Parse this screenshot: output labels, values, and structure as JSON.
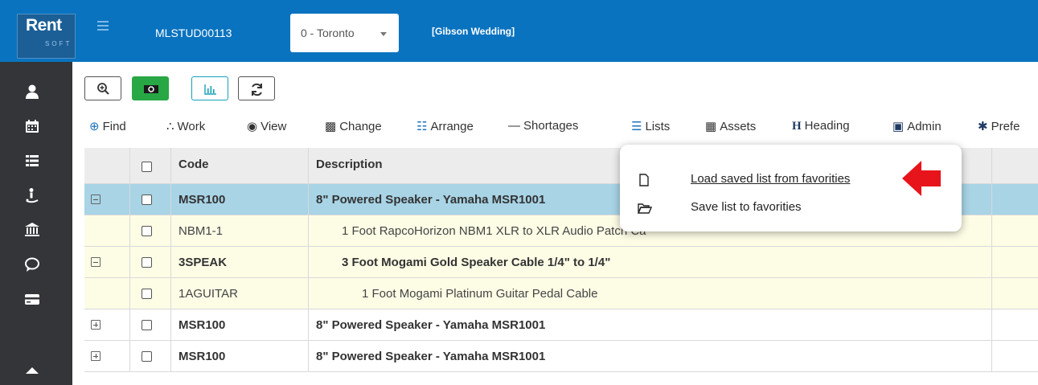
{
  "header": {
    "logo_text": "Rent",
    "logo_sub": "SOFT",
    "job_code": "MLSTUD00113",
    "location": "0 - Toronto",
    "job_name": "[Gibson Wedding]"
  },
  "sidebar": {
    "icons": [
      "user-icon",
      "calendar-icon",
      "list-icon",
      "person-dolly-icon",
      "bank-icon",
      "chat-icon",
      "card-icon",
      "tag-icon"
    ]
  },
  "toolbar": {
    "buttons": [
      "zoom-in-icon",
      "money-icon",
      "chart-icon",
      "refresh-icon"
    ],
    "money_color": "#28a745",
    "chart_color": "#17a2b8"
  },
  "menubar": {
    "items": [
      {
        "label": "Find",
        "icon": "search-plus-icon"
      },
      {
        "label": "Work",
        "icon": "spinner-icon"
      },
      {
        "label": "View",
        "icon": "eye-icon"
      },
      {
        "label": "Change",
        "icon": "edit-icon"
      },
      {
        "label": "Arrange",
        "icon": "sitemap-icon"
      },
      {
        "label": "Shortages",
        "icon": "minus-icon"
      },
      {
        "label": "Lists",
        "icon": "list-icon"
      },
      {
        "label": "Assets",
        "icon": "calendar-icon"
      },
      {
        "label": "Heading",
        "icon": "heading-icon"
      },
      {
        "label": "Admin",
        "icon": "lock-icon"
      },
      {
        "label": "Prefe",
        "icon": "gear-icon"
      }
    ]
  },
  "grid": {
    "headers": {
      "code": "Code",
      "description": "Description"
    },
    "rows": [
      {
        "toggle": "minus",
        "code": "MSR100",
        "description": "8\" Powered Speaker - Yamaha MSR1001",
        "bold": true,
        "selected": true,
        "indent": 0
      },
      {
        "toggle": "",
        "code": "NBM1-1",
        "description": "1 Foot RapcoHorizon NBM1 XLR to XLR Audio Patch Ca",
        "bold": false,
        "selected": false,
        "indent": 1
      },
      {
        "toggle": "minus",
        "code": "3SPEAK",
        "description": "3 Foot Mogami Gold Speaker Cable 1/4\" to 1/4\"",
        "bold": true,
        "selected": false,
        "indent": 1
      },
      {
        "toggle": "",
        "code": "1AGUITAR",
        "description": "1 Foot Mogami Platinum Guitar Pedal Cable",
        "bold": false,
        "selected": false,
        "indent": 2
      },
      {
        "toggle": "plus",
        "code": "MSR100",
        "description": "8\" Powered Speaker - Yamaha MSR1001",
        "bold": true,
        "selected": false,
        "indent": 0
      },
      {
        "toggle": "plus",
        "code": "MSR100",
        "description": "8\" Powered Speaker - Yamaha MSR1001",
        "bold": true,
        "selected": false,
        "indent": 0
      }
    ]
  },
  "popup": {
    "load_label": "Load saved list from favorities",
    "save_label": "Save list to favorities"
  },
  "colors": {
    "header_bg": "#0a73bf",
    "sidebar_bg": "#333538",
    "selected_row": "#a8d4e6",
    "child_row": "#fdfde6",
    "arrow": "#e8141b"
  }
}
